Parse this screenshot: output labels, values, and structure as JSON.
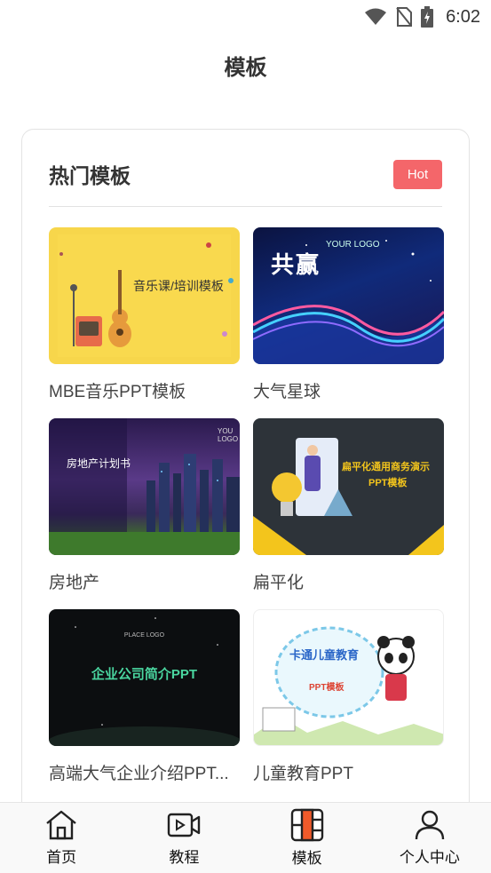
{
  "status_bar": {
    "time": "6:02"
  },
  "header": {
    "title": "模板"
  },
  "section": {
    "title": "热门模板",
    "badge": "Hot"
  },
  "templates": [
    {
      "label": "MBE音乐PPT模板",
      "thumb_text": "音乐课/培训模板"
    },
    {
      "label": "大气星球",
      "thumb_text": "共赢",
      "thumb_subtext": "YOUR LOGO"
    },
    {
      "label": "房地产",
      "thumb_text": "房地产计划书",
      "thumb_subtext": "YOU LOGO"
    },
    {
      "label": "扁平化",
      "thumb_text": "扁平化通用商务演示",
      "thumb_text2": "PPT模板"
    },
    {
      "label": "高端大气企业介绍PPT...",
      "thumb_text": "企业公司简介PPT",
      "thumb_subtext": "PLACE LOGO"
    },
    {
      "label": "儿童教育PPT",
      "thumb_text": "卡通儿童教育",
      "thumb_text2": "PPT模板"
    }
  ],
  "bottom_nav": [
    {
      "label": "首页",
      "icon": "home-icon"
    },
    {
      "label": "教程",
      "icon": "video-icon"
    },
    {
      "label": "模板",
      "icon": "template-icon"
    },
    {
      "label": "个人中心",
      "icon": "user-icon"
    }
  ],
  "colors": {
    "accent": "#f4666a",
    "text": "#333333"
  }
}
